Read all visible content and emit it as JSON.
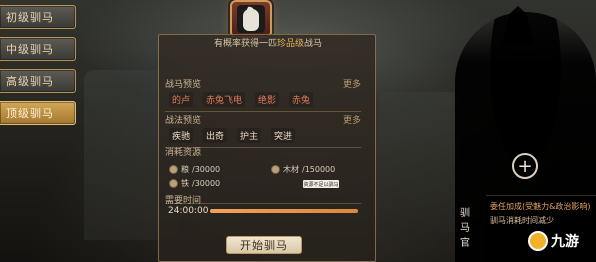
{
  "tabs": [
    {
      "label": "初级驯马",
      "active": false
    },
    {
      "label": "中级驯马",
      "active": false
    },
    {
      "label": "高级驯马",
      "active": false
    },
    {
      "label": "顶级驯马",
      "active": true
    }
  ],
  "header": {
    "prefix": "有概率获得一匹",
    "highlight": "珍品级",
    "suffix": "战马"
  },
  "war_horse_preview": {
    "title": "战马预览",
    "more": "更多",
    "items": [
      "的卢",
      "赤兔飞电",
      "绝影",
      "赤兔"
    ]
  },
  "tactics_preview": {
    "title": "战法预览",
    "more": "更多",
    "items": [
      "疾驰",
      "出奇",
      "护主",
      "突进"
    ]
  },
  "resources": {
    "title": "消耗资源",
    "rows": [
      {
        "left_label": "粮",
        "left_value": "/30000",
        "right_label": "木材",
        "right_value": "/150000"
      },
      {
        "left_label": "铁",
        "left_value": "/30000"
      }
    ],
    "tooltip": "资源不足以驯马"
  },
  "time": {
    "title": "需要时间",
    "value": "24:00:00",
    "progress_percent": 100
  },
  "start_button": {
    "label": "开始驯马"
  },
  "side": {
    "official_label": "驯马官",
    "line1": "委任加成(受魅力&政治影响)",
    "line2": "驯马消耗时间减少"
  },
  "watermark": {
    "text": "九游"
  },
  "colors": {
    "accent_gold": "#d09a58",
    "preview_red": "#e07a5a",
    "bar_orange": "#f0a35a"
  }
}
